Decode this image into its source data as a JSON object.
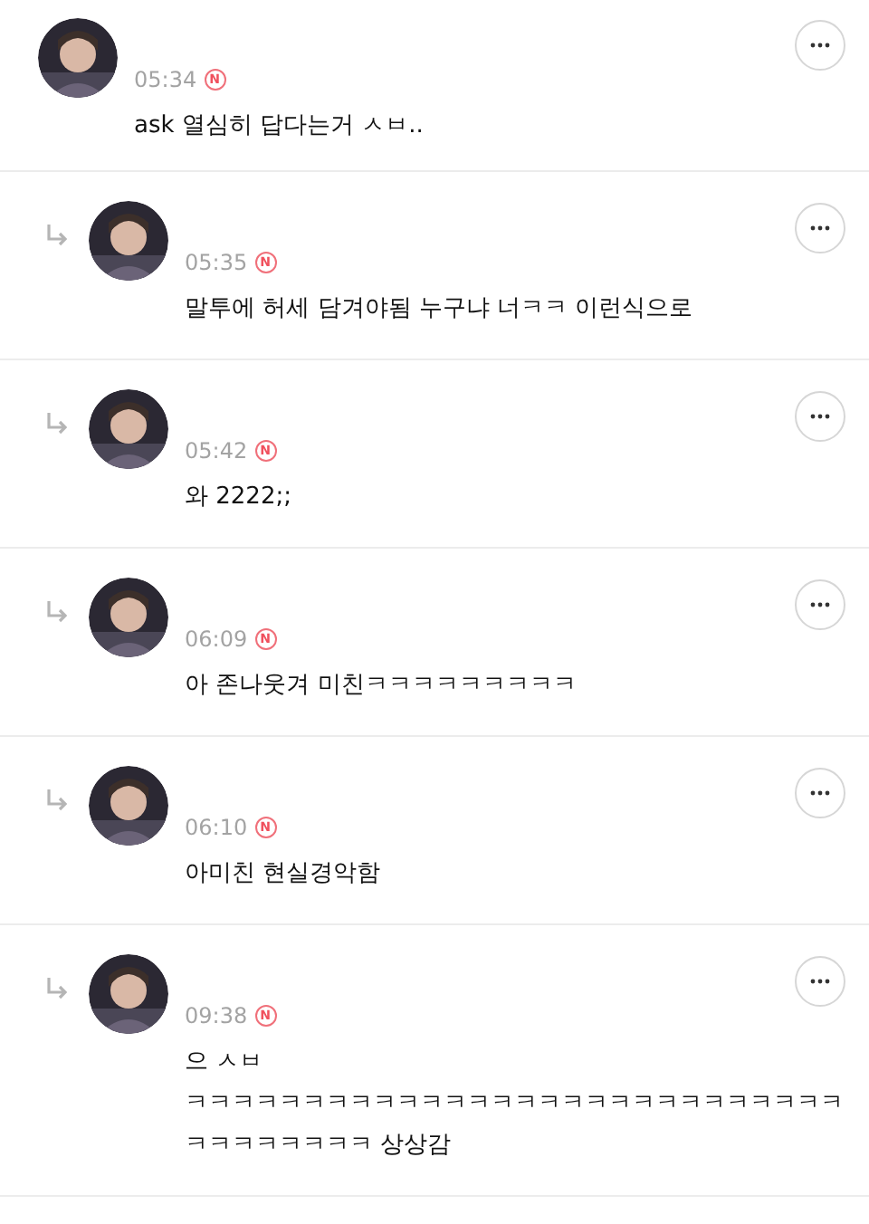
{
  "comments": [
    {
      "reply": false,
      "time": "05:34",
      "badge": "N",
      "lines": [
        "ask 열심히 답다는거 ㅅㅂ.."
      ]
    },
    {
      "reply": true,
      "time": "05:35",
      "badge": "N",
      "lines": [
        "말투에 허세 담겨야됨 누구냐 너ㅋㅋ 이런식으로"
      ]
    },
    {
      "reply": true,
      "time": "05:42",
      "badge": "N",
      "lines": [
        "와 2222;;"
      ]
    },
    {
      "reply": true,
      "time": "06:09",
      "badge": "N",
      "lines": [
        "아 존나웃겨 미친ㅋㅋㅋㅋㅋㅋㅋㅋㅋ"
      ]
    },
    {
      "reply": true,
      "time": "06:10",
      "badge": "N",
      "lines": [
        "아미친 현실경악함"
      ]
    },
    {
      "reply": true,
      "time": "09:38",
      "badge": "N",
      "lines": [
        "으 ㅅㅂ",
        "ㅋㅋㅋㅋㅋㅋㅋㅋㅋㅋㅋㅋㅋㅋㅋㅋㅋㅋㅋㅋㅋㅋㅋㅋㅋㅋㅋㅋㅋㅋㅋㅋㅋㅋㅋㅋ 상상감"
      ]
    }
  ]
}
